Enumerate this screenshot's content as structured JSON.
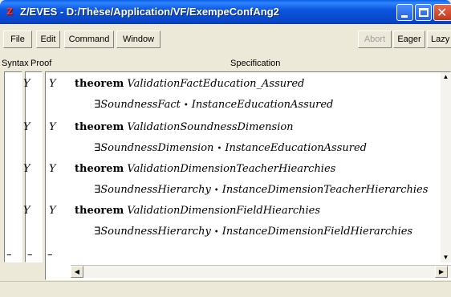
{
  "window": {
    "app_icon_glyph": "Z",
    "title": "Z/EVES - D:/Thèse/Application/VF/ExempeConfAng2"
  },
  "menu": {
    "file": "File",
    "edit": "Edit",
    "command": "Command",
    "window": "Window"
  },
  "toolbar": {
    "abort": "Abort",
    "eager": "Eager",
    "lazy": "Lazy"
  },
  "columns": {
    "syntax": "Syntax",
    "proof": "Proof",
    "specification": "Specification"
  },
  "entries": [
    {
      "syntax": "Y",
      "proof": "Y",
      "keyword": "theorem",
      "name": "ValidationFactEducation_Assured",
      "exists_symbol": "∃",
      "var": "SoundnessFact",
      "spot": "•",
      "body": "InstanceEducationAssured"
    },
    {
      "syntax": "Y",
      "proof": "Y",
      "keyword": "theorem",
      "name": "ValidationSoundnessDimension",
      "exists_symbol": "∃",
      "var": "SoundnessDimension",
      "spot": "•",
      "body": "InstanceEducationAssured"
    },
    {
      "syntax": "Y",
      "proof": "Y",
      "keyword": "theorem",
      "name": "ValidationDimensionTeacherHiearchies",
      "exists_symbol": "∃",
      "var": "SoundnessHierarchy",
      "spot": "•",
      "body": "InstanceDimensionTeacherHierarchies"
    },
    {
      "syntax": "Y",
      "proof": "Y",
      "keyword": "theorem",
      "name": "ValidationDimensionFieldHiearchies",
      "exists_symbol": "∃",
      "var": "SoundnessHierarchy",
      "spot": "•",
      "body": "InstanceDimensionFieldHierarchies"
    }
  ],
  "empty_row": {
    "syntax": "–",
    "proof": "–",
    "spec": "–"
  },
  "icons": {
    "app": "zeves-app-icon",
    "minimize": "minimize-icon",
    "maximize": "maximize-icon",
    "close": "close-icon",
    "scroll_up": "arrow-up-icon",
    "scroll_down": "arrow-down-icon",
    "scroll_left": "arrow-left-icon",
    "scroll_right": "arrow-right-icon"
  }
}
